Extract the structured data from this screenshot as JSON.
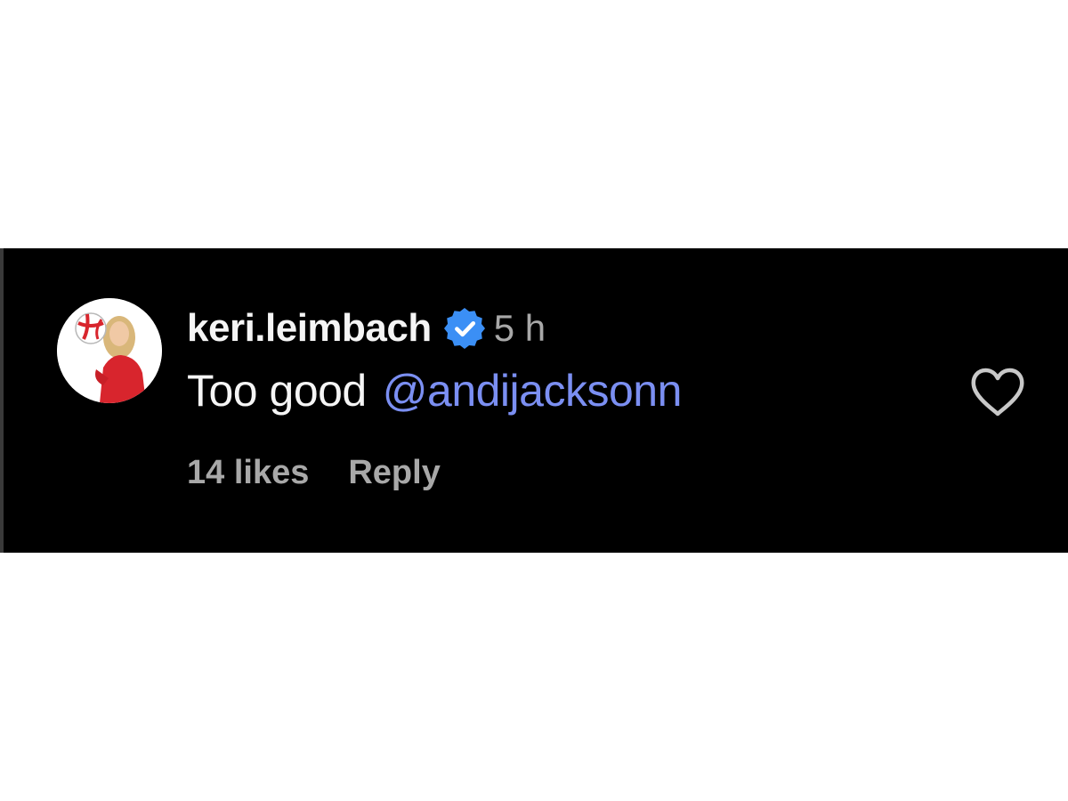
{
  "comment": {
    "username": "keri.leimbach",
    "verified": true,
    "timestamp": "5 h",
    "text": "Too good",
    "mention": "@andijacksonn",
    "likes": "14 likes",
    "reply_label": "Reply"
  },
  "icons": {
    "verified": "verified-badge-icon",
    "like": "heart-outline-icon",
    "avatar": "profile-photo"
  },
  "colors": {
    "background": "#000000",
    "primary_text": "#f5f5f5",
    "secondary_text": "#a8a8a8",
    "mention": "#7b8ff2",
    "verified_badge": "#3b8ff5"
  }
}
